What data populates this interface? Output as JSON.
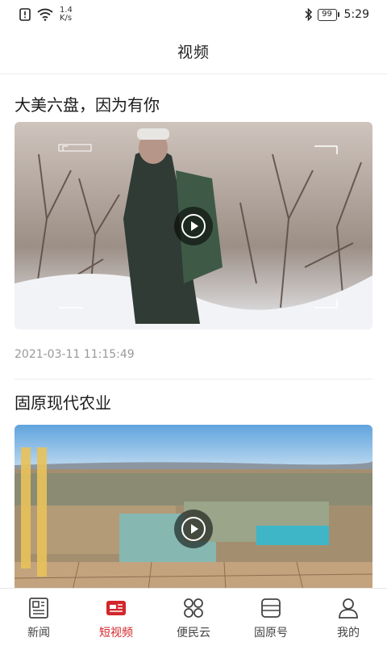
{
  "status_bar": {
    "net_speed_value": "1.4",
    "net_speed_unit": "K/s",
    "battery": "99",
    "time": "5:29"
  },
  "header": {
    "title": "视频"
  },
  "feed": [
    {
      "title": "大美六盘，因为有你",
      "date": "2021-03-11 11:15:49",
      "thumb_icon": "play-icon"
    },
    {
      "title": "固原现代农业",
      "thumb_icon": "play-icon"
    }
  ],
  "nav": [
    {
      "label": "新闻",
      "icon": "newspaper-icon",
      "active": false
    },
    {
      "label": "短视频",
      "icon": "short-video-icon",
      "active": true
    },
    {
      "label": "便民云",
      "icon": "services-grid-icon",
      "active": false
    },
    {
      "label": "固原号",
      "icon": "account-icon",
      "active": false
    },
    {
      "label": "我的",
      "icon": "profile-icon",
      "active": false
    }
  ],
  "colors": {
    "accent": "#d3262b",
    "inactive": "#444444"
  }
}
